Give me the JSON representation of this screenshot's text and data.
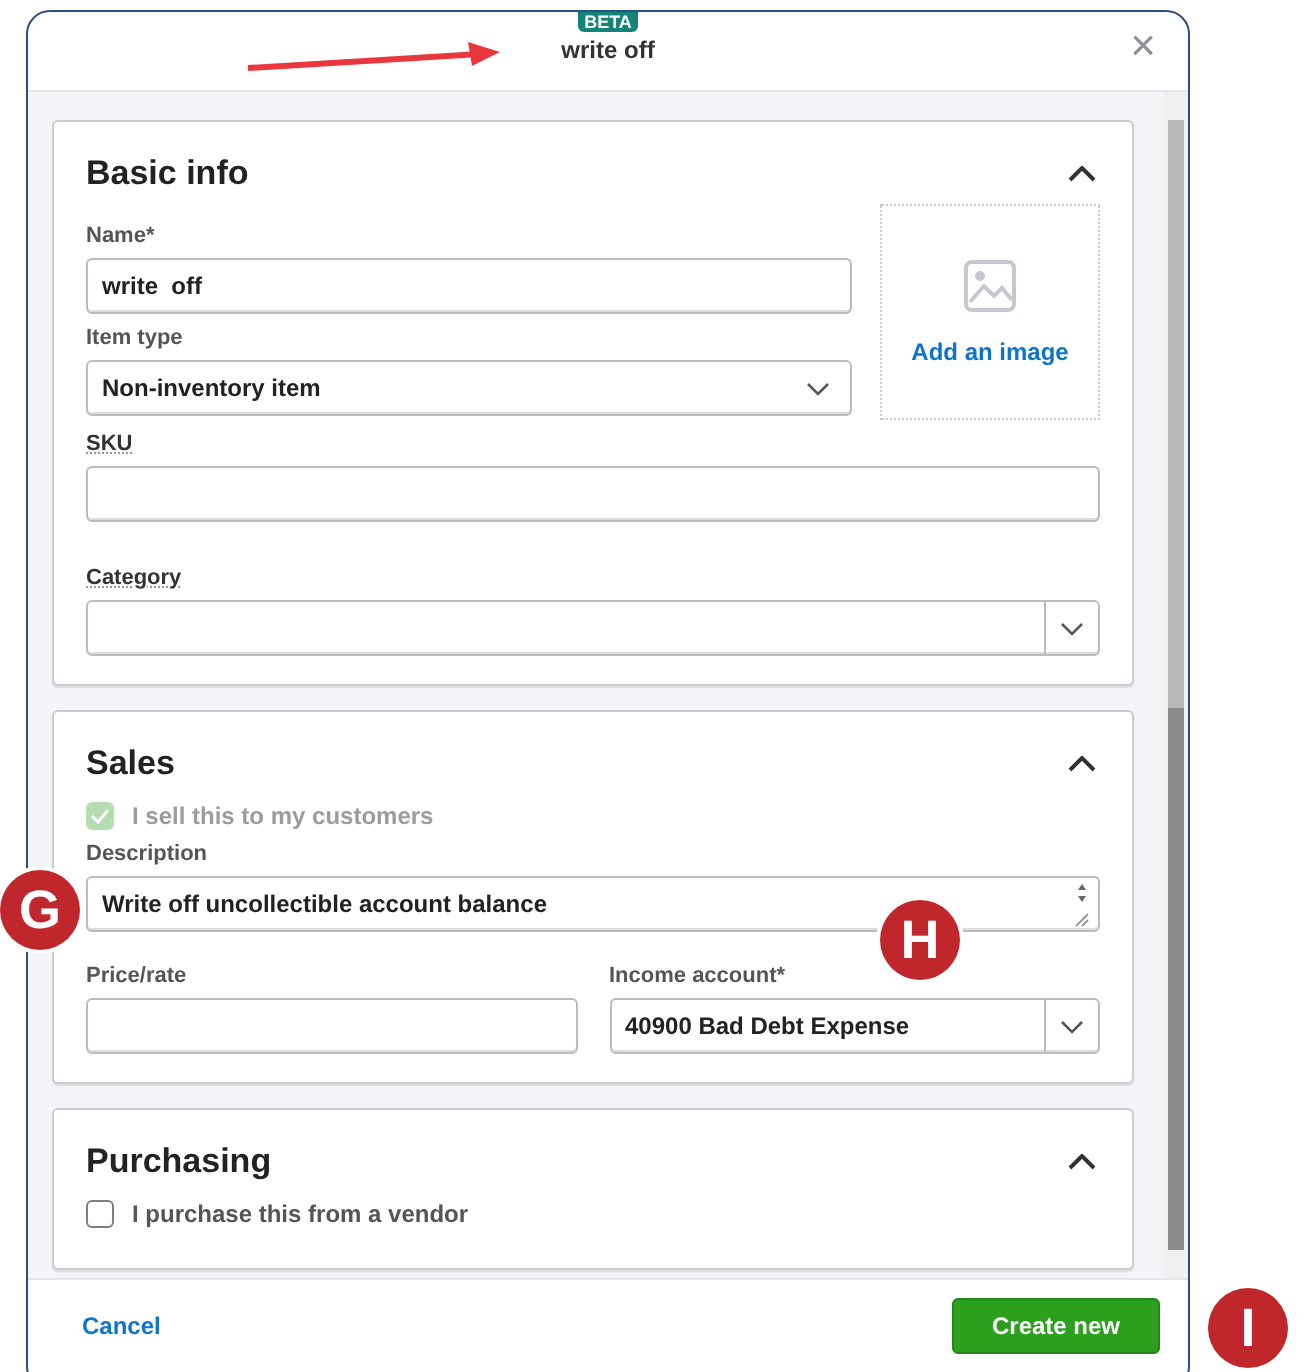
{
  "dialog": {
    "badge": "BETA",
    "title": "write off",
    "close": "×"
  },
  "basic_info": {
    "title": "Basic info",
    "expanded": true,
    "name": {
      "label": "Name*",
      "value": "write  off"
    },
    "item_type": {
      "label": "Item type",
      "value": "Non-inventory item"
    },
    "image_link": "Add an image",
    "sku": {
      "label": "SKU"
    },
    "category": {
      "label": "Category"
    }
  },
  "sales": {
    "title": "Sales",
    "expanded": true,
    "sell_checkbox": {
      "label": "I sell this to my customers",
      "checked": true,
      "disabled": true
    },
    "description": {
      "label": "Description",
      "value": "Write off uncollectible account balance"
    },
    "price": {
      "label": "Price/rate"
    },
    "income_account": {
      "label": "Income account*",
      "value": "40900 Bad Debt Expense"
    }
  },
  "purchasing": {
    "title": "Purchasing",
    "expanded": true,
    "purchase_checkbox": {
      "label": "I purchase this from a vendor",
      "checked": false,
      "disabled": false
    }
  },
  "footer": {
    "cancel": "Cancel",
    "create": "Create new"
  },
  "callouts": [
    {
      "label": "G"
    },
    {
      "label": "H"
    },
    {
      "label": "I"
    }
  ]
}
